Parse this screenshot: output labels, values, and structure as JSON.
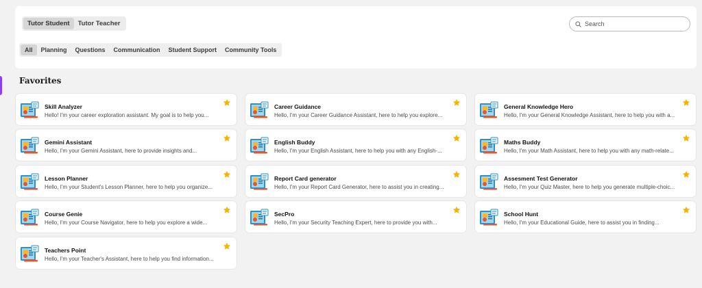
{
  "roles": [
    {
      "label": "Tutor Student",
      "active": true
    },
    {
      "label": "Tutor Teacher",
      "active": false
    }
  ],
  "filters": [
    {
      "label": "All",
      "active": true
    },
    {
      "label": "Planning",
      "active": false
    },
    {
      "label": "Questions",
      "active": false
    },
    {
      "label": "Communication",
      "active": false
    },
    {
      "label": "Student Support",
      "active": false
    },
    {
      "label": "Community Tools",
      "active": false
    }
  ],
  "search": {
    "placeholder": "Search",
    "value": ""
  },
  "favorites": {
    "title": "Favorites",
    "items": [
      {
        "name": "Skill Analyzer",
        "desc": "Hello! I'm your career exploration assistant. My goal is to help you...",
        "starred": true
      },
      {
        "name": "Career Guidance",
        "desc": "Hello, I'm your Career Guidance Assistant, here to help you explore...",
        "starred": true
      },
      {
        "name": "General Knowledge Hero",
        "desc": "Hello, I'm your General Knowledge Assistant, here to help you with a...",
        "starred": true
      },
      {
        "name": "Gemini Assistant",
        "desc": "Hello, I'm your Gemini Assistant, here to provide insights and...",
        "starred": true
      },
      {
        "name": "English Buddy",
        "desc": "Hello, I'm your English Assistant, here to help you with any English-...",
        "starred": true
      },
      {
        "name": "Maths Buddy",
        "desc": "Hello, I'm your Math Assistant, here to help you with any math-relate...",
        "starred": true
      },
      {
        "name": "Lesson Planner",
        "desc": "Hello, I'm your Student's Lesson Planner, here to help you organize...",
        "starred": true
      },
      {
        "name": "Report Card generator",
        "desc": "Hello, I'm your Report Card Generator, here to assist you in creating...",
        "starred": true
      },
      {
        "name": "Assesment Test Generator",
        "desc": "Hello, I'm your Quiz Master, here to help you generate multiple-choic...",
        "starred": true
      },
      {
        "name": "Course Genie",
        "desc": "Hello, I'm your Course Navigator, here to help you explore a wide...",
        "starred": true
      },
      {
        "name": "SecPro",
        "desc": "Hello, I'm your Security Teaching Expert, here to provide you with...",
        "starred": true
      },
      {
        "name": "School Hunt",
        "desc": "Hello, I'm your Educational Guide, here to assist you in finding...",
        "starred": true
      },
      {
        "name": "Teachers Point",
        "desc": "Hello, I'm your Teacher's Assistant, here to help you find information...",
        "starred": true
      }
    ]
  },
  "icons": {
    "search": "search-icon",
    "star": "star-icon",
    "assistant": "assistant-thumbnail-icon"
  },
  "colors": {
    "accent": "#8a3ffc",
    "star": "#f5b400",
    "background": "#f3f2f2"
  }
}
